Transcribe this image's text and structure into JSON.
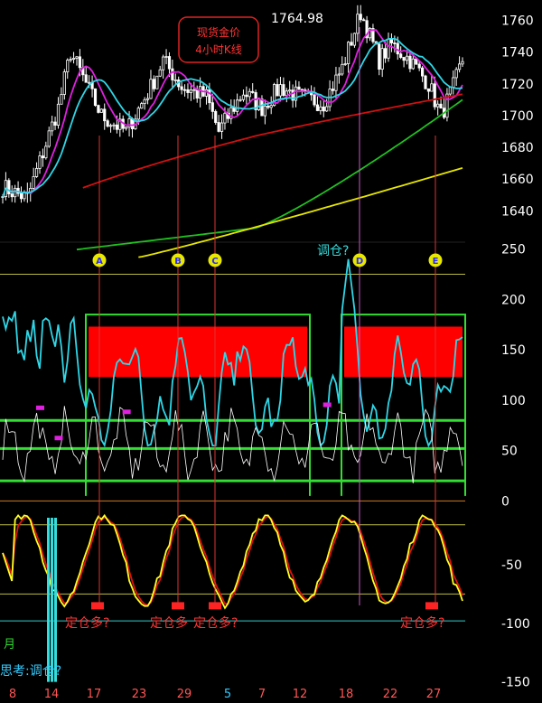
{
  "title_box": {
    "line1": "现货金价",
    "line2": "4小时K线"
  },
  "price_label": "1764.98",
  "panels": {
    "price": {
      "ticks": [
        "1760",
        "1740",
        "1720",
        "1700",
        "1680",
        "1660",
        "1640"
      ],
      "ylim": [
        1622,
        1770
      ]
    },
    "indicator1": {
      "ticks": [
        "250",
        "200",
        "150",
        "100",
        "50",
        "0"
      ],
      "ylim": [
        -5,
        255
      ]
    },
    "indicator2": {
      "ticks": [
        "-50",
        "-100",
        "-150"
      ],
      "ylim": [
        -168,
        0
      ]
    }
  },
  "markers": [
    "A",
    "B",
    "C",
    "D",
    "E"
  ],
  "annotations": {
    "tiaocang_top": "调仓?",
    "dingcang_1": "定仓多?",
    "dingcang_2": "定仓多",
    "dingcang_3": "定仓多?",
    "dingcang_4": "定仓多?",
    "side_1": "月",
    "side_2": "思考:调仓?"
  },
  "x_axis": [
    "8",
    "14",
    "17",
    "23",
    "29",
    "5",
    "7",
    "12",
    "18",
    "22",
    "27"
  ],
  "colors": {
    "background": "#000000",
    "candles": "#ffffff",
    "ma_cyan": "#2fd6e6",
    "ma_magenta": "#e020e0",
    "ma_red": "#d01010",
    "ma_green": "#20c020",
    "ma_yellow": "#e6e600",
    "guide_green": "#33dd33",
    "fill_red": "#ff0000",
    "marker_fill": "#e8e800",
    "marker_text": "#2a2aff",
    "annotation_red": "#ff3333",
    "tick_white": "#ffffff",
    "axis_day_red": "#ff5555",
    "axis_day_cyan": "#33ccff"
  },
  "chart_data": {
    "type": "line",
    "title": "现货金价 4小时K线",
    "price_last": 1764.98,
    "series": [],
    "price_range": [
      1630,
      1765
    ],
    "indicator_range": [
      0,
      250
    ],
    "oscillator_range": [
      -150,
      0
    ]
  }
}
